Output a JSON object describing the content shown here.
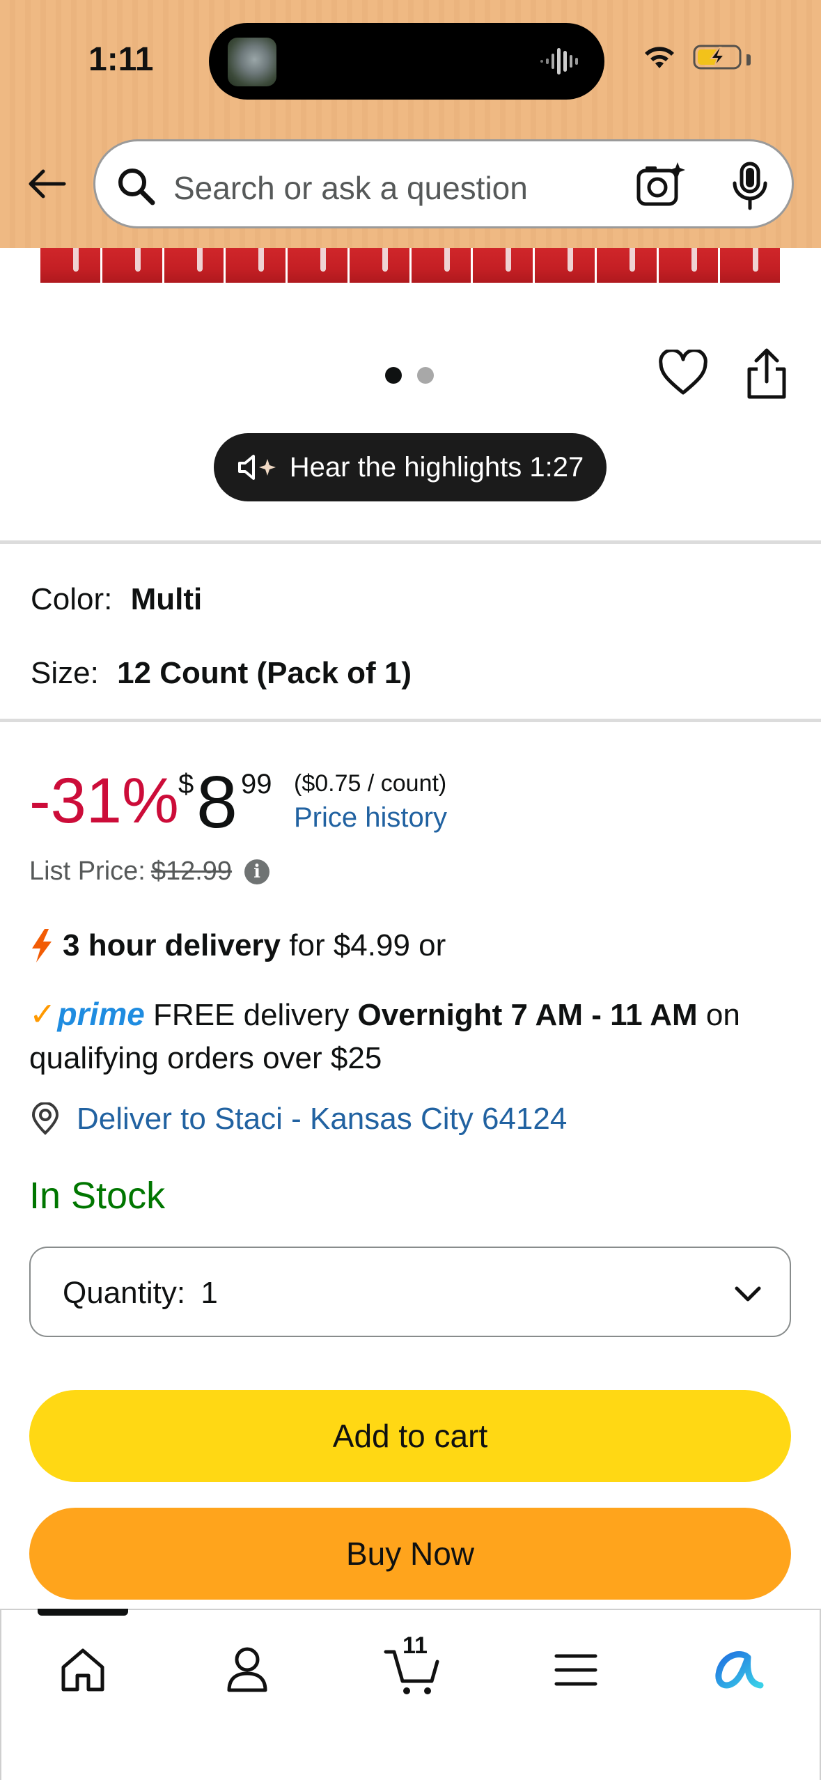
{
  "status_bar": {
    "time": "1:11"
  },
  "search": {
    "placeholder": "Search or ask a question"
  },
  "carousel": {
    "page_count": 2,
    "active_index": 0
  },
  "highlights": {
    "label": "Hear the highlights 1:27"
  },
  "options": {
    "color_label": "Color:",
    "color_value": "Multi",
    "size_label": "Size:",
    "size_value": "12 Count (Pack of 1)"
  },
  "price": {
    "discount": "-31%",
    "currency_symbol": "$",
    "whole": "8",
    "fraction": "99",
    "unit_price": "($0.75 / count)",
    "history_link": "Price history",
    "list_price_label": "List Price:",
    "list_price_value": "$12.99"
  },
  "delivery": {
    "fast_bold": "3 hour delivery",
    "fast_rest": "for $4.99 or",
    "prime_word": "prime",
    "free_text": "FREE delivery",
    "window_bold": "Overnight 7 AM - 11 AM",
    "tail": "on qualifying orders over $25",
    "deliver_to": "Deliver to Staci - Kansas City 64124"
  },
  "stock": {
    "status": "In Stock"
  },
  "quantity": {
    "label": "Quantity:",
    "value": "1"
  },
  "actions": {
    "add_to_cart": "Add to cart",
    "buy_now": "Buy Now"
  },
  "bottom_nav": {
    "cart_count": "11"
  },
  "colors": {
    "header_bg": "#edb780",
    "discount_red": "#cc0c39",
    "link_blue": "#2162a1",
    "stock_green": "#007600",
    "add_to_cart_yellow": "#ffd814",
    "buy_now_orange": "#ffa41c"
  }
}
